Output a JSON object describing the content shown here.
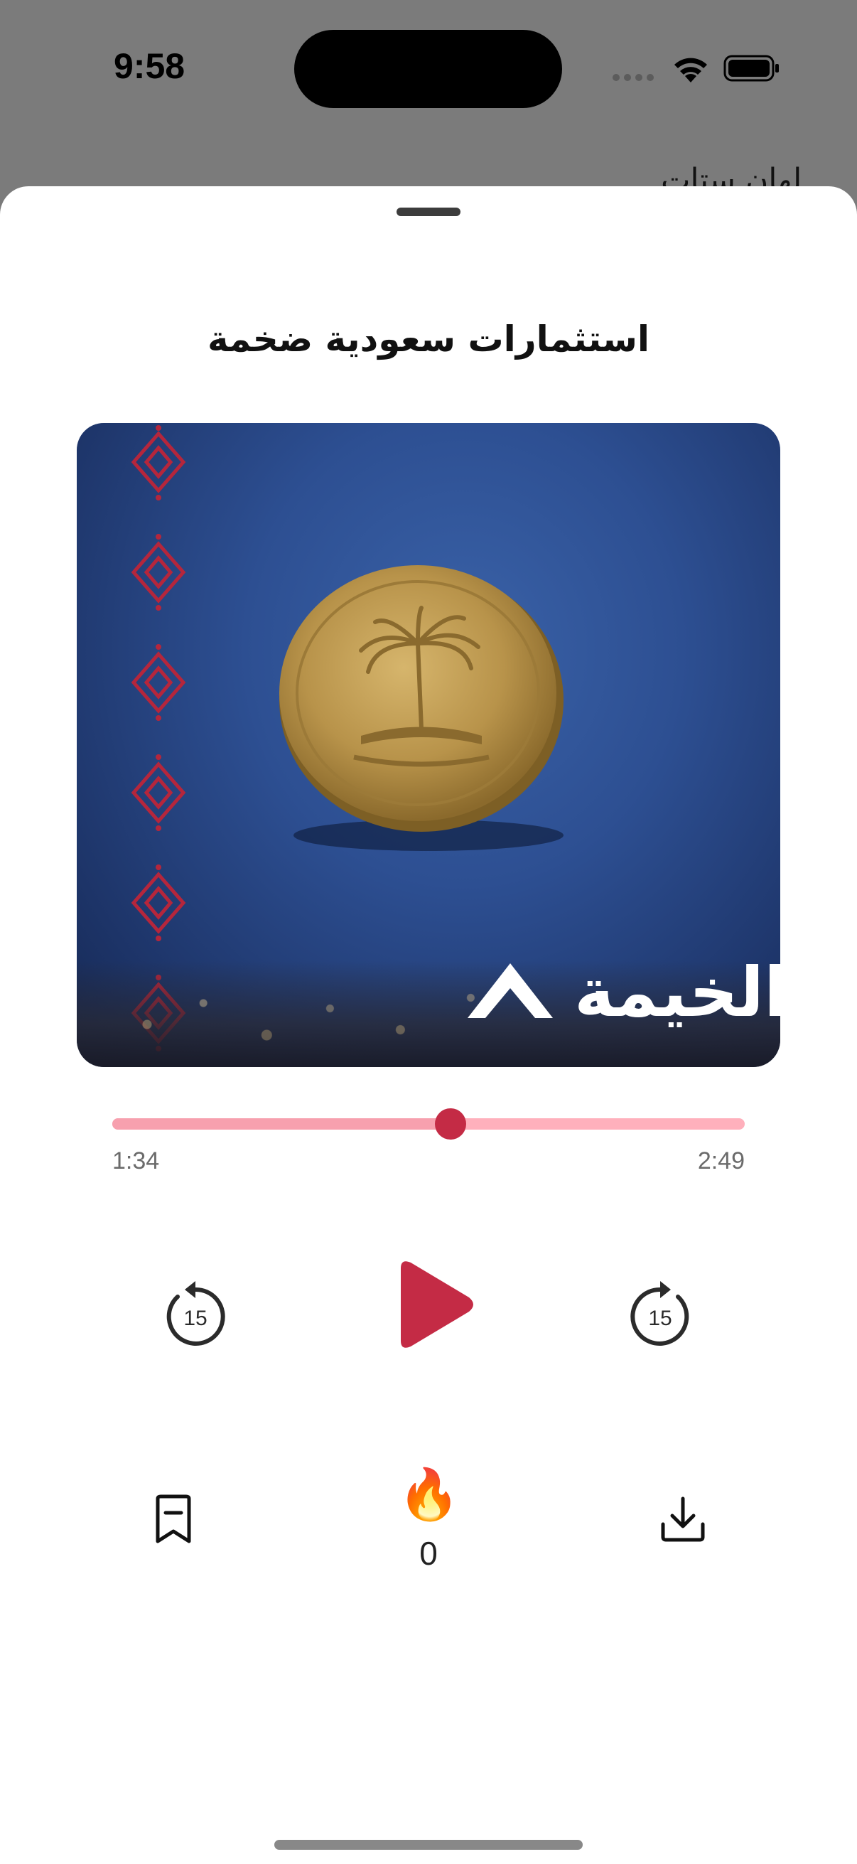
{
  "status_bar": {
    "time": "9:58",
    "behind_text": "لهان ستات"
  },
  "sheet": {
    "title": "استثمارات سعودية ضخمة",
    "artwork": {
      "brand_text": "الخيمة",
      "brand_logo_icon": "tent-icon"
    }
  },
  "player": {
    "progress_fraction": 0.535,
    "elapsed": "1:34",
    "total": "2:49",
    "skip_back_seconds": "15",
    "skip_forward_seconds": "15",
    "accent_color": "#c42b45",
    "track_color": "#ffb0bc"
  },
  "actions": {
    "reaction_emoji": "🔥",
    "reaction_count": "0"
  }
}
